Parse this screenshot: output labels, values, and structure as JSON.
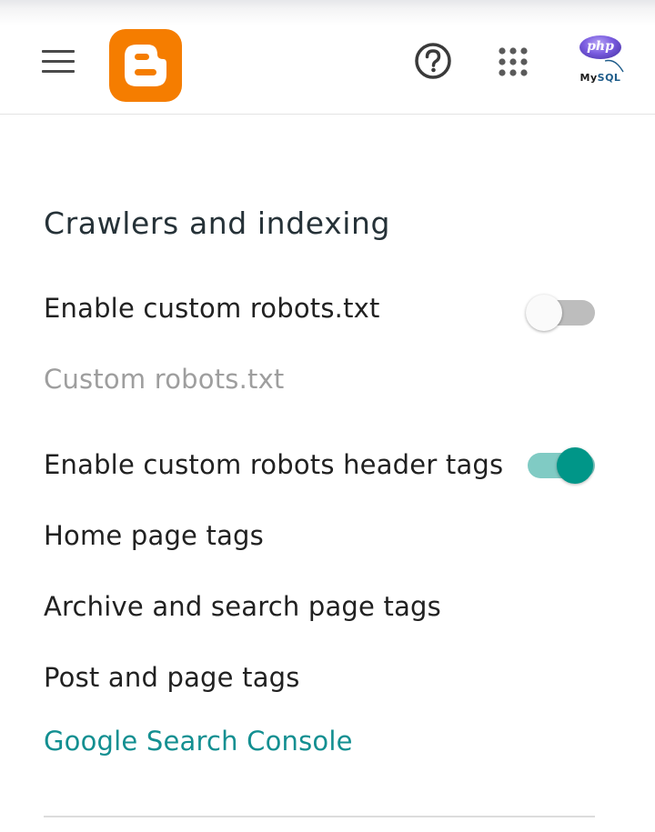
{
  "header": {
    "menu_icon": "hamburger-menu-icon",
    "logo_icon": "blogger-logo-icon",
    "help_icon": "help-circle-icon",
    "apps_icon": "apps-grid-icon",
    "avatar": {
      "php_text": "php",
      "mysql_text_a": "My",
      "mysql_text_b": "SQL"
    },
    "colors": {
      "logo": "#f57d00"
    }
  },
  "section": {
    "title": "Crawlers and indexing",
    "items": [
      {
        "label": "Enable custom robots.txt",
        "type": "toggle",
        "enabled": false
      },
      {
        "label": "Custom robots.txt",
        "type": "disabled-setting"
      },
      {
        "label": "Enable custom robots header tags",
        "type": "toggle",
        "enabled": true
      },
      {
        "label": "Home page tags",
        "type": "setting"
      },
      {
        "label": "Archive and search page tags",
        "type": "setting"
      },
      {
        "label": "Post and page tags",
        "type": "setting"
      },
      {
        "label": "Google Search Console",
        "type": "link"
      }
    ]
  },
  "colors": {
    "accent": "#009688",
    "accent_track": "#80cbc4",
    "link": "#138f91",
    "disabled_text": "#9e9e9e"
  }
}
